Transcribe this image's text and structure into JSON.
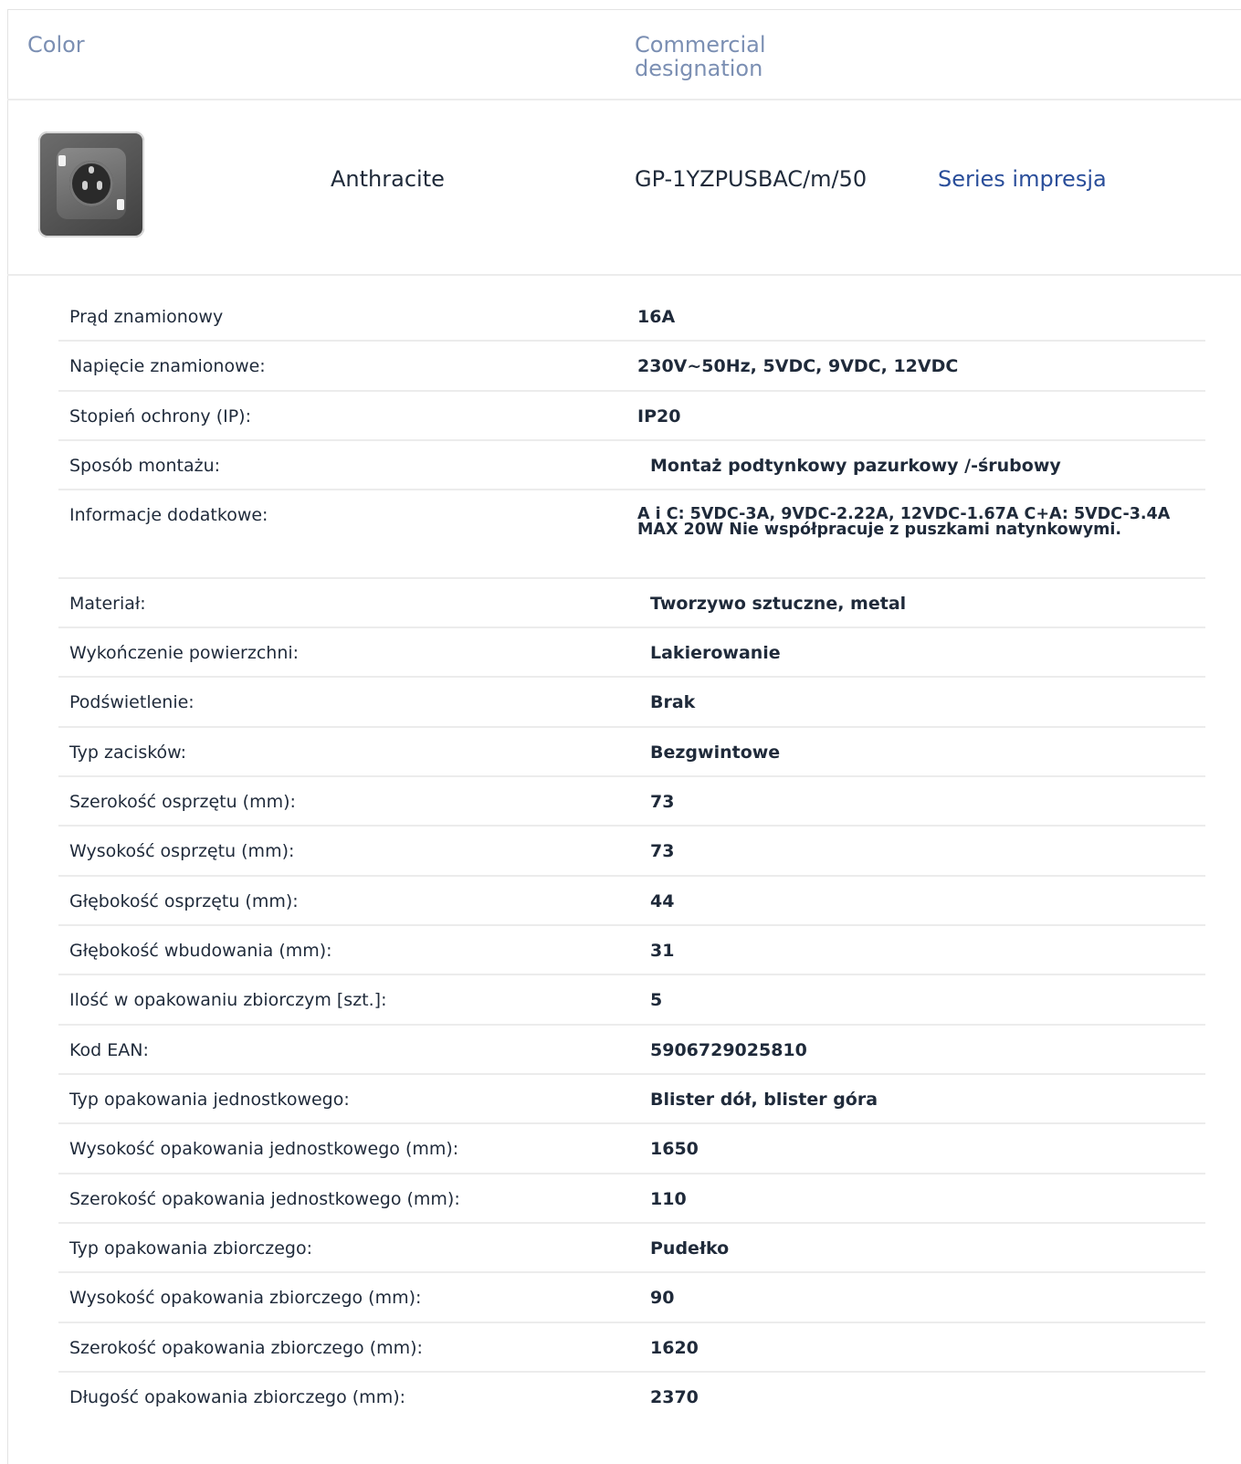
{
  "header": {
    "color_label": "Color",
    "designation_label": "Commercial designation"
  },
  "product": {
    "image_icon": "anthracite-socket-thumbnail",
    "color": "Anthracite",
    "designation": "GP-1YZPUSBAC/m/50",
    "series_link": "Series impresja"
  },
  "specs": [
    {
      "label": "Prąd znamionowy",
      "value": "16A"
    },
    {
      "label": "Napięcie znamionowe:",
      "value": "230V~50Hz, 5VDC, 9VDC, 12VDC"
    },
    {
      "label": "Stopień ochrony (IP):",
      "value": "IP20"
    },
    {
      "label": "Sposób montażu:",
      "value": "Montaż podtynkowy pazurkowy /-śrubowy"
    },
    {
      "label": "Informacje dodatkowe:",
      "value": "A i C: 5VDC-3A, 9VDC-2.22A, 12VDC-1.67A C+A: 5VDC-3.4A MAX 20W Nie współpracuje z puszkami natynkowymi."
    },
    {
      "label": "Materiał:",
      "value": "Tworzywo sztuczne, metal"
    },
    {
      "label": "Wykończenie powierzchni:",
      "value": "Lakierowanie"
    },
    {
      "label": "Podświetlenie:",
      "value": "Brak"
    },
    {
      "label": "Typ zacisków:",
      "value": "Bezgwintowe"
    },
    {
      "label": "Szerokość osprzętu (mm):",
      "value": "73"
    },
    {
      "label": "Wysokość osprzętu (mm):",
      "value": "73"
    },
    {
      "label": "Głębokość osprzętu (mm):",
      "value": "44"
    },
    {
      "label": "Głębokość wbudowania (mm):",
      "value": "31"
    },
    {
      "label": "Ilość w opakowaniu zbiorczym [szt.]:",
      "value": "5"
    },
    {
      "label": "Kod EAN:",
      "value": "5906729025810"
    },
    {
      "label": "Typ opakowania jednostkowego:",
      "value": "Blister dół, blister góra"
    },
    {
      "label": "Wysokość opakowania jednostkowego (mm):",
      "value": "1650"
    },
    {
      "label": "Szerokość opakowania jednostkowego (mm):",
      "value": "110"
    },
    {
      "label": "Typ opakowania zbiorczego:",
      "value": "Pudełko"
    },
    {
      "label": "Wysokość opakowania zbiorczego (mm):",
      "value": "90"
    },
    {
      "label": "Szerokość opakowania zbiorczego (mm):",
      "value": "1620"
    },
    {
      "label": "Długość opakowania zbiorczego (mm):",
      "value": "2370"
    }
  ]
}
